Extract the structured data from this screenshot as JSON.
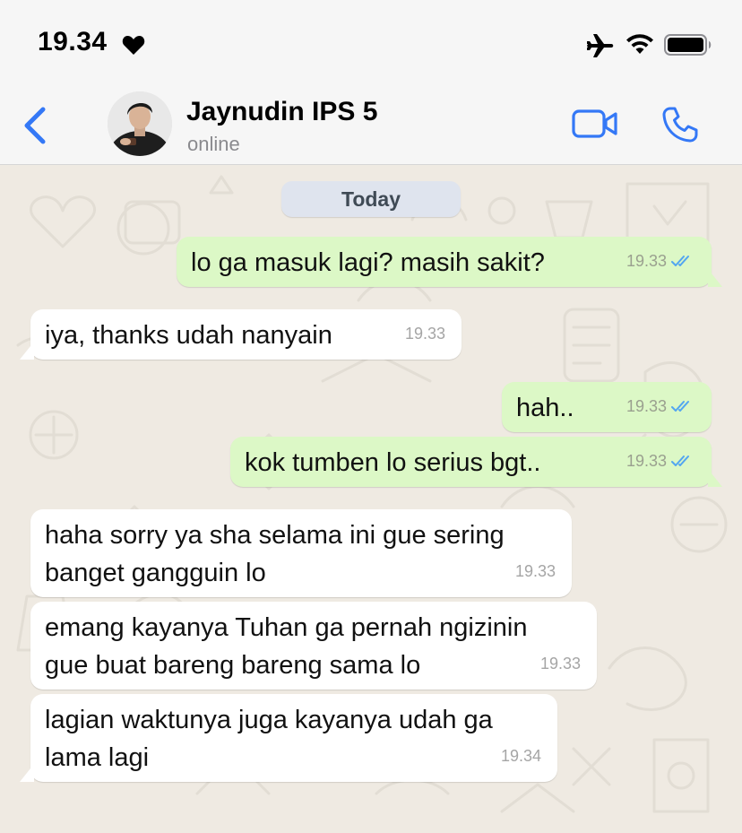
{
  "status_bar": {
    "time": "19.34",
    "icons": [
      "heart-icon",
      "airplane-mode-icon",
      "wifi-icon",
      "battery-icon"
    ]
  },
  "header": {
    "back_icon": "chevron-left-icon",
    "contact_name": "Jaynudin IPS 5",
    "contact_status": "online",
    "actions": [
      "video-call-icon",
      "phone-call-icon"
    ],
    "accent_color": "#3478f6"
  },
  "chat": {
    "date_separator": "Today",
    "messages": [
      {
        "direction": "out",
        "text": "lo ga masuk lagi? masih sakit?",
        "time": "19.33",
        "read": true
      },
      {
        "direction": "in",
        "text": "iya, thanks udah nanyain",
        "time": "19.33"
      },
      {
        "direction": "out",
        "text": "hah..",
        "time": "19.33",
        "read": true
      },
      {
        "direction": "out",
        "text": "kok tumben lo serius bgt..",
        "time": "19.33",
        "read": true
      },
      {
        "direction": "in",
        "text": "haha sorry ya sha selama ini gue sering\nbanget gangguin lo",
        "time": "19.33"
      },
      {
        "direction": "in",
        "text": "emang kayanya Tuhan ga pernah ngizinin\ngue buat bareng bareng sama lo",
        "time": "19.33"
      },
      {
        "direction": "in",
        "text": "lagian waktunya juga kayanya udah ga\nlama lagi",
        "time": "19.34"
      }
    ],
    "colors": {
      "outgoing_bubble": "#dcf8c6",
      "incoming_bubble": "#ffffff",
      "read_tick": "#53a6f0",
      "wallpaper": "#efeae2"
    }
  }
}
